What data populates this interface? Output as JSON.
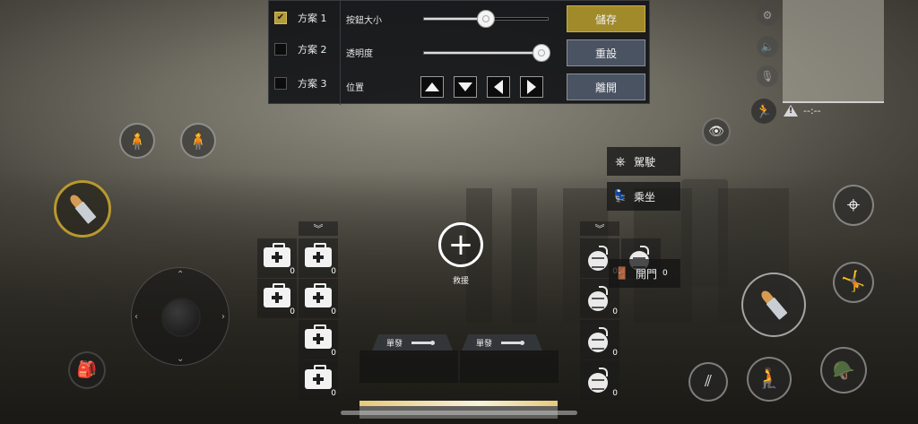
{
  "settings_panel": {
    "schemes": [
      {
        "label": "方案 1",
        "checked": true
      },
      {
        "label": "方案 2",
        "checked": false
      },
      {
        "label": "方案 3",
        "checked": false
      }
    ],
    "settings": {
      "button_size": {
        "label": "按鈕大小",
        "value": 0.5
      },
      "opacity": {
        "label": "透明度",
        "value": 0.95
      },
      "position": {
        "label": "位置"
      }
    },
    "buttons": {
      "save": "儲存",
      "reset": "重設",
      "leave": "離開"
    }
  },
  "hud": {
    "warning_text": "--:--",
    "icons": {
      "settings": "gear-icon",
      "speaker": "speaker-icon",
      "mic": "microphone-icon",
      "sprint": "sprint-icon"
    },
    "rescue_label": "救援",
    "drive_label": "駕駛",
    "ride_label": "乘坐",
    "door_label": "開門",
    "door_count": "0",
    "weapon_slot_1": "單發",
    "weapon_slot_2": "單發",
    "medkits": [
      {
        "count": "0"
      },
      {
        "count": "0"
      },
      {
        "count": "0"
      },
      {
        "count": "0"
      },
      {
        "count": "0"
      },
      {
        "count": "0"
      }
    ],
    "grenades": [
      {
        "count": "0"
      },
      {
        "count": "0"
      },
      {
        "count": "0"
      },
      {
        "count": "0"
      }
    ],
    "colors": {
      "gold": "#b8982f",
      "panel": "#14151a",
      "button_blue": "#4a5362"
    }
  }
}
